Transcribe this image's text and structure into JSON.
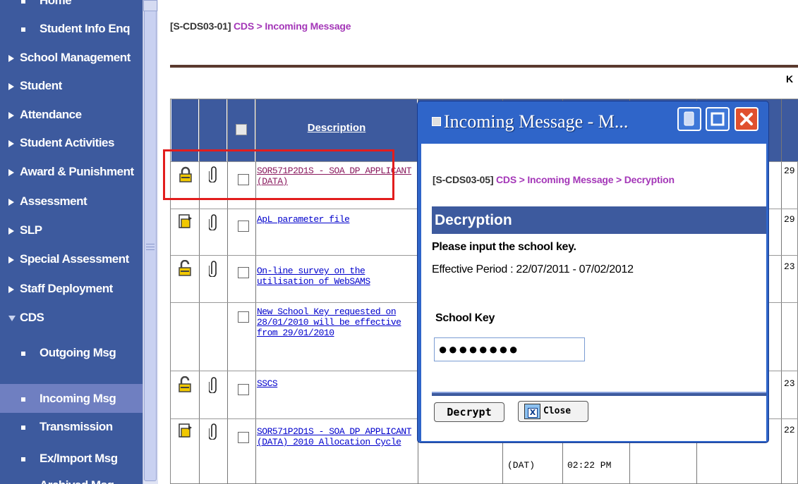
{
  "sidebar": {
    "items": [
      {
        "label": "Home",
        "kind": "sub"
      },
      {
        "label": "Student Info Enq",
        "kind": "sub"
      },
      {
        "label": "School Management",
        "kind": "top"
      },
      {
        "label": "Student",
        "kind": "top"
      },
      {
        "label": "Attendance",
        "kind": "top"
      },
      {
        "label": "Student Activities",
        "kind": "top"
      },
      {
        "label": "Award & Punishment",
        "kind": "top"
      },
      {
        "label": "Assessment",
        "kind": "top"
      },
      {
        "label": "SLP",
        "kind": "top"
      },
      {
        "label": "Special Assessment",
        "kind": "top"
      },
      {
        "label": "Staff Deployment",
        "kind": "top"
      },
      {
        "label": "CDS",
        "kind": "open"
      },
      {
        "label": "Outgoing Msg",
        "kind": "sub"
      },
      {
        "label": "Incoming Msg",
        "kind": "sub",
        "active": true
      },
      {
        "label": "Transmission",
        "kind": "sub"
      },
      {
        "label": "Ex/Import Msg",
        "kind": "sub"
      },
      {
        "label": "Archived Msg",
        "kind": "sub"
      }
    ]
  },
  "breadcrumb": {
    "code": "[S-CDS03-01]",
    "path": "CDS > Incoming Message"
  },
  "pager": {
    "symbol": "K"
  },
  "table": {
    "header": {
      "description": "Description"
    },
    "rows": [
      {
        "icon": "lock-icon",
        "desc": "SOR571P2D1S - SOA DP APPLICANT (DATA)",
        "highlight": true,
        "right": "29"
      },
      {
        "icon": "doc-icon",
        "desc": "ApL parameter file",
        "right": "29"
      },
      {
        "icon": "unlock-icon",
        "desc": "On-line survey on the utilisation of WebSAMS",
        "right": "23"
      },
      {
        "icon": "",
        "desc": "New School Key requested on 28/01/2010 will be effective from 29/01/2010",
        "right": ""
      },
      {
        "icon": "unlock-icon",
        "desc": "SSCS",
        "right": "23"
      },
      {
        "icon": "doc-icon",
        "desc": "SOR571P2D1S - SOA DP APPLICANT (DATA) 2010 Allocation Cycle",
        "right": "22",
        "col4": "(DAT)",
        "col5": "02:22 PM"
      }
    ]
  },
  "popup": {
    "title": "Incoming Message - M...",
    "breadcrumb": {
      "code": "[S-CDS03-05]",
      "path": "CDS > Incoming Message > Decryption"
    },
    "heading": "Decryption",
    "prompt": "Please input the school key.",
    "effective": "Effective Period : 22/07/2011 - 07/02/2012",
    "key_label": "School Key",
    "key_value": "●●●●●●●●",
    "decrypt_label": "Decrypt",
    "close_label": "Close"
  },
  "colors": {
    "nav_bg": "#3d5a9e",
    "nav_active": "#6f7fc1",
    "popup_frame": "#2f65c9",
    "highlight": "#e21d1d",
    "crumb_path": "#a437b8"
  }
}
